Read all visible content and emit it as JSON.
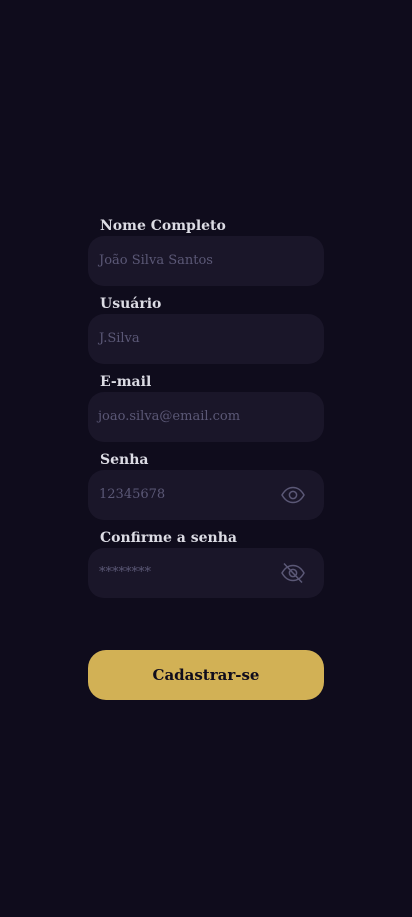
{
  "form": {
    "full_name": {
      "label": "Nome Completo",
      "value": "João Silva Santos"
    },
    "username": {
      "label": "Usuário",
      "value": "J.Silva"
    },
    "email": {
      "label": "E-mail",
      "value": "joao.silva@email.com"
    },
    "password": {
      "label": "Senha",
      "value": "12345678",
      "visibility_icon": "eye-icon"
    },
    "confirm_password": {
      "label": "Confirme a senha",
      "value": "********",
      "visibility_icon": "eye-off-icon"
    },
    "submit_label": "Cadastrar-se"
  },
  "colors": {
    "background": "#0f0c1c",
    "input_background": "#1a1629",
    "label": "#dcdce4",
    "input_text": "#5b5876",
    "accent": "#d2b155"
  }
}
